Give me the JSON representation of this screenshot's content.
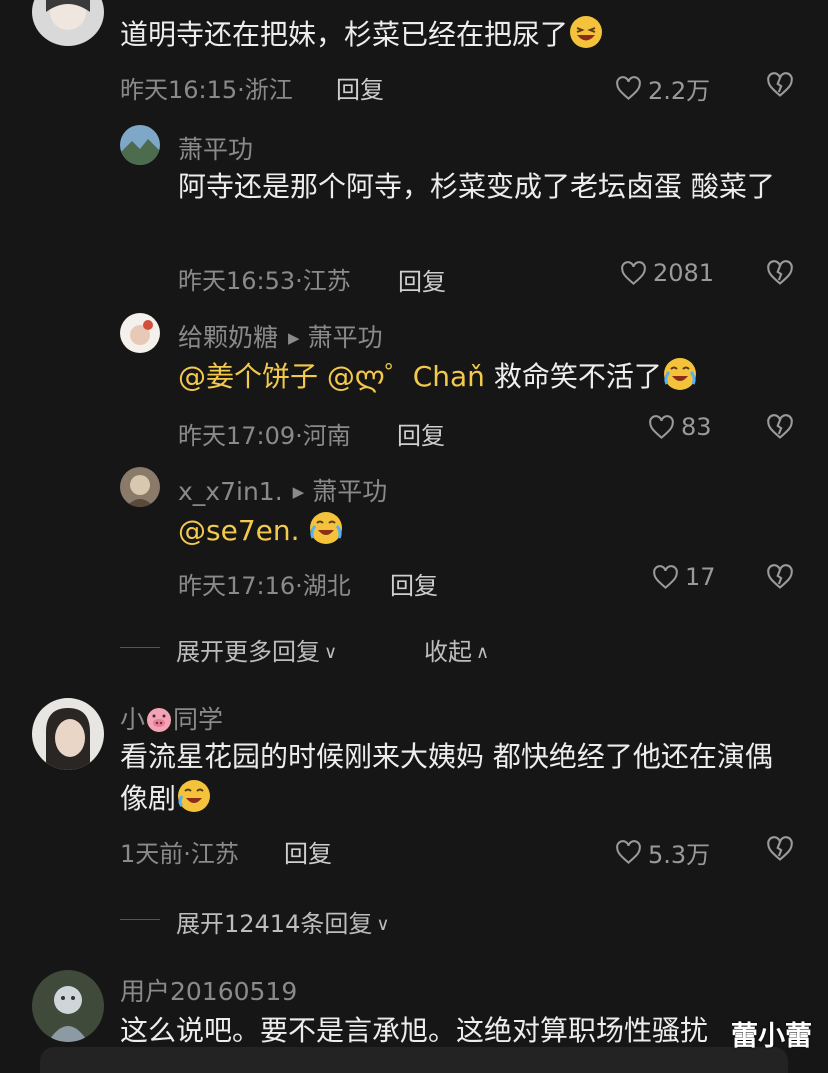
{
  "comments": [
    {
      "id": "c1",
      "text": "道明寺还在把妹，杉菜已经在把尿了",
      "time_loc": "昨天16:15·浙江",
      "reply_label": "回复",
      "likes": "2.2万"
    },
    {
      "id": "r1",
      "user": "萧平功",
      "text": "阿寺还是那个阿寺，杉菜变成了老坛卤蛋 酸菜了",
      "time_loc": "昨天16:53·江苏",
      "reply_label": "回复",
      "likes": "2081"
    },
    {
      "id": "r2",
      "user": "给颗奶糖",
      "reply_to": "萧平功",
      "mention1": "@姜个饼子",
      "mention2": "@ლ゜Chaň",
      "text": "救命笑不活了",
      "time_loc": "昨天17:09·河南",
      "reply_label": "回复",
      "likes": "83"
    },
    {
      "id": "r3",
      "user": "x_x7in1.",
      "reply_to": "萧平功",
      "mention1": "@se7en.",
      "time_loc": "昨天17:16·湖北",
      "reply_label": "回复",
      "likes": "17"
    },
    {
      "id": "c2",
      "user_pre": "小",
      "user_post": "同学",
      "text": "看流星花园的时候刚来大姨妈  都快绝经了他还在演偶像剧",
      "time_loc": "1天前·江苏",
      "reply_label": "回复",
      "likes": "5.3万"
    },
    {
      "id": "c3",
      "user": "用户20160519",
      "text": "这么说吧。要不是言承旭。这绝对算职场性骚扰"
    }
  ],
  "thread_controls": {
    "expand_more": "展开更多回复",
    "collapse": "收起",
    "expand_count": "展开12414条回复"
  },
  "watermark": "蕾小蕾",
  "colors": {
    "background": "#161616",
    "mention": "#f2c94c",
    "meta": "#8a8a8a"
  },
  "icons": [
    "heart-outline-icon",
    "broken-heart-icon",
    "chevron-down-icon",
    "chevron-up-icon",
    "play-triangle-icon",
    "laughing-emoji",
    "crying-laughing-emoji",
    "pig-face-emoji"
  ]
}
